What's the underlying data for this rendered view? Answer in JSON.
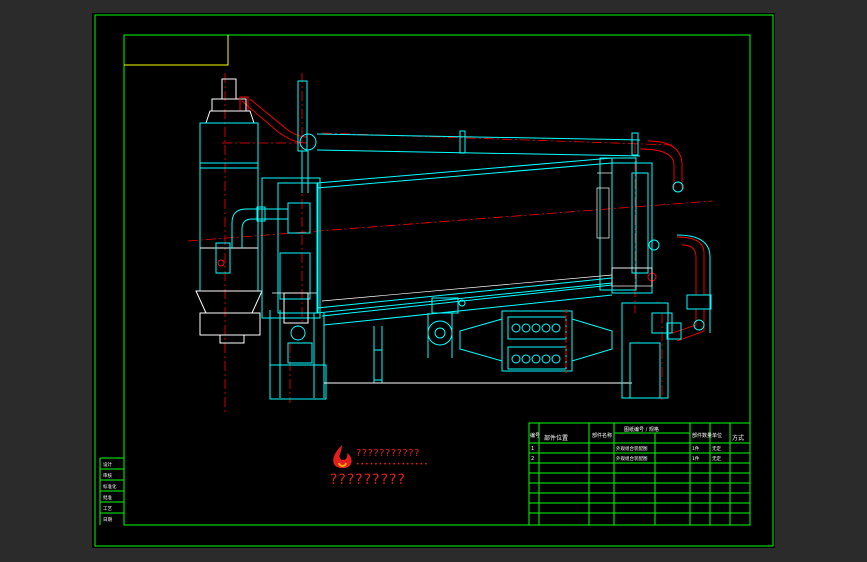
{
  "brand": {
    "logo_icon": "flame-logo-icon",
    "code_text": "???????????",
    "sub_text": "••••••••••••••••",
    "name_text": "?????????",
    "color": "#e21f1f"
  },
  "title_block": {
    "header": [
      "编号",
      "部件位置",
      "部件名称",
      "图纸编号 / 规格",
      "部件数量",
      "单位",
      "方式"
    ],
    "rows": [
      [
        "1",
        "",
        "",
        "外观组合装配图",
        "",
        "1件",
        "无定"
      ],
      [
        "2",
        "",
        "",
        "外观组合装配图",
        "",
        "1件",
        "无定"
      ]
    ]
  },
  "left_strip": [
    "设计",
    "审核",
    "标准化",
    "批准",
    "工艺",
    "日期"
  ],
  "colors": {
    "frame": "#00ff00",
    "drawing_line": "#00ffff",
    "center_line": "#ff0000",
    "white_line": "#ffffff",
    "label_box": "#ffff00"
  }
}
